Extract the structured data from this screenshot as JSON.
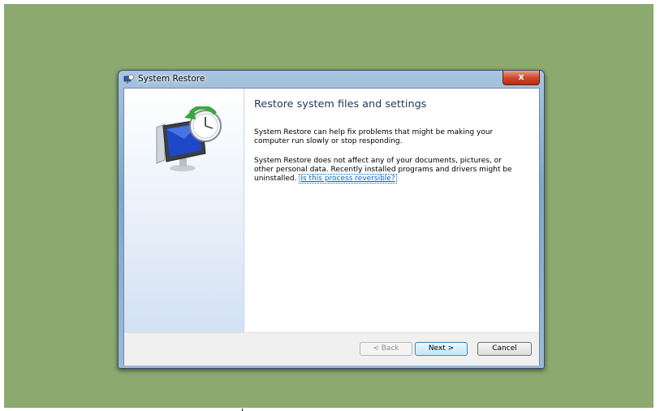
{
  "window": {
    "title": "System Restore",
    "title_icon": "system-restore-icon",
    "close_glyph": "x",
    "close_icon": "close-icon"
  },
  "side_panel": {
    "illustration_icon": "system-restore-clock-monitor-icon"
  },
  "content": {
    "heading": "Restore system files and settings",
    "paragraph1": "System Restore can help fix problems that might be making your computer run slowly or stop responding.",
    "paragraph2": "System Restore does not affect any of your documents, pictures, or other personal data. Recently installed programs and drivers might be uninstalled.",
    "link": "Is this process reversible?"
  },
  "footer": {
    "back_label": "< Back",
    "next_label": "Next >",
    "cancel_label": "Cancel"
  },
  "colors": {
    "background": "#8ca96f",
    "heading": "#1e395b",
    "link": "#0066cc",
    "close_button": "#cf4a2f"
  }
}
